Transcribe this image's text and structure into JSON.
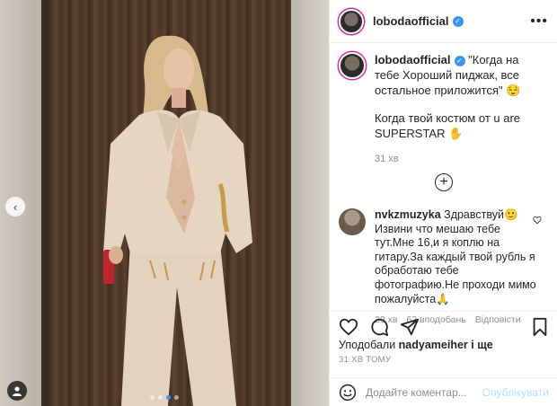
{
  "post": {
    "username": "lobodaofficial",
    "caption_text": "\"Когда на тебе Хороший пиджак, все остальное приложится\" 😌",
    "caption_line2": "Когда твой костюм от u are SUPERSTAR ✋",
    "caption_time": "31 хв",
    "likes_prefix": "Уподобали",
    "likes_user": "nadyameiher",
    "likes_suffix": "і ще",
    "posted_time": "31 ХВ ТОМУ",
    "slide_count": 4,
    "active_slide": 2
  },
  "comment": {
    "username": "nvkzmuzyka",
    "text": "Здравствуй🙂 Извини что мешаю тебе тут.Мне 16,и я коплю на гитару.За каждый твой рубль я обработаю тебе фотографию.Не проходи мимо пожалуйста🙏",
    "time": "29 хв",
    "likes": "62 вподобань",
    "reply": "Відповісти"
  },
  "composer": {
    "placeholder": "Додайте коментар...",
    "publish": "Опублікувати"
  },
  "icons": {
    "more": "more-icon",
    "verified": "verified-icon",
    "like": "heart-icon",
    "comment": "comment-icon",
    "share": "share-icon",
    "save": "bookmark-icon",
    "emoji": "emoji-icon",
    "add": "plus-icon",
    "prev": "chevron-left-icon",
    "tag": "user-tag-icon"
  },
  "colors": {
    "accent": "#3897f0",
    "publish_disabled": "#b2dffc",
    "muted": "#8e8e8e"
  }
}
